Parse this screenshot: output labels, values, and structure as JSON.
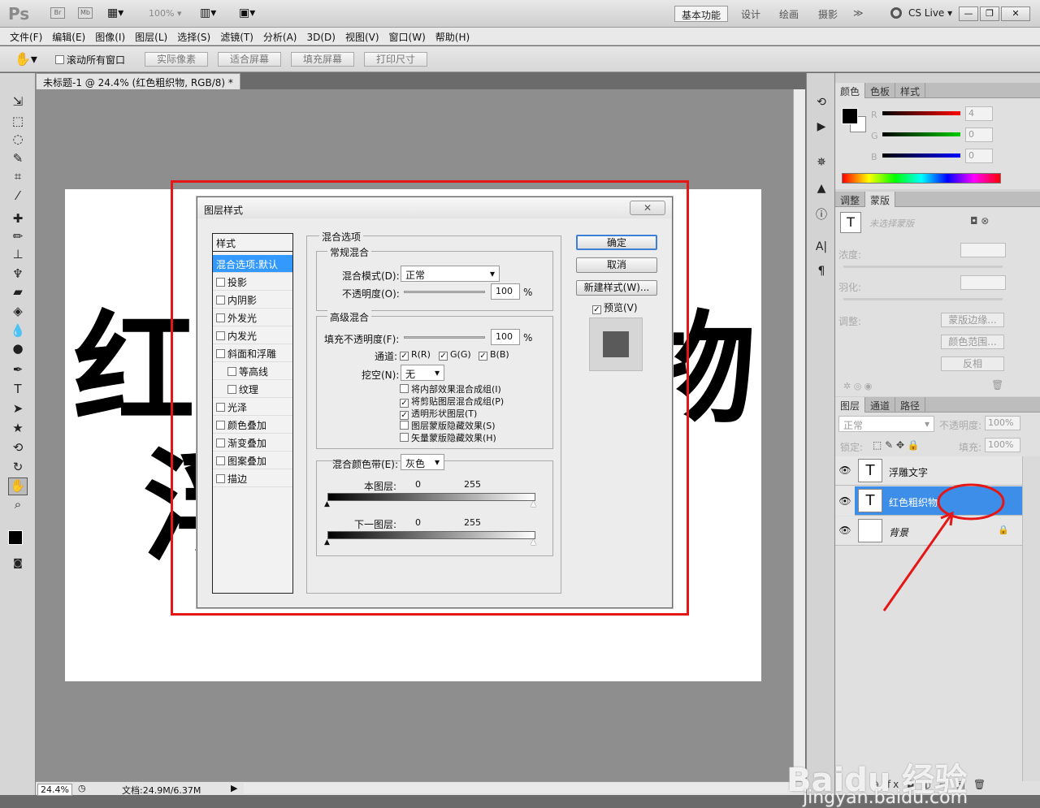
{
  "appbar": {
    "logo": "Ps",
    "icons": [
      "Br",
      "Mb"
    ],
    "zoom": "100%",
    "workspaces": [
      "基本功能",
      "设计",
      "绘画",
      "摄影"
    ],
    "more": "≫",
    "cslive": "CS Live ▾",
    "window_buttons": [
      "—",
      "❐",
      "✕"
    ]
  },
  "menu": [
    "文件(F)",
    "编辑(E)",
    "图像(I)",
    "图层(L)",
    "选择(S)",
    "滤镜(T)",
    "分析(A)",
    "3D(D)",
    "视图(V)",
    "窗口(W)",
    "帮助(H)"
  ],
  "options": {
    "scroll_all": "滚动所有窗口",
    "buttons": [
      "实际像素",
      "适合屏幕",
      "填充屏幕",
      "打印尺寸"
    ]
  },
  "document": {
    "tab_title": "未标题-1 @ 24.4% (红色粗织物, RGB/8) *",
    "canvas_text_line1": [
      "红",
      "物"
    ],
    "canvas_text_line2": "浮",
    "zoom": "24.4%",
    "doc_info": "文档:24.9M/6.37M"
  },
  "color_panel": {
    "tabs": [
      "颜色",
      "色板",
      "样式"
    ],
    "r_label": "R",
    "g_label": "G",
    "b_label": "B",
    "r": "4",
    "g": "0",
    "b": "0"
  },
  "mask_panel": {
    "tabs": [
      "调整",
      "蒙版"
    ],
    "status": "未选择蒙版",
    "density": "浓度:",
    "feather": "羽化:",
    "refine_label": "调整:",
    "buttons": [
      "蒙版边缘...",
      "颜色范围...",
      "反相"
    ]
  },
  "layers_panel": {
    "tabs": [
      "图层",
      "通道",
      "路径"
    ],
    "blend_mode": "正常",
    "opacity_label": "不透明度:",
    "opacity": "100%",
    "lock_label": "锁定:",
    "fill_label": "填充:",
    "fill": "100%",
    "layers": [
      {
        "name": "浮雕文字",
        "thumb": "T",
        "selected": false
      },
      {
        "name": "红色粗织物",
        "thumb": "T",
        "selected": true
      },
      {
        "name": "背景",
        "thumb": "",
        "selected": false
      }
    ],
    "bottom_icons": "⊖ fx ◘ ◐ ▭ ▣ 🗑"
  },
  "watermark": {
    "brand": "Baidu 经验",
    "url": "jingyan.baidu.com"
  },
  "dialog": {
    "title": "图层样式",
    "styles_header": "样式",
    "styles": [
      {
        "label": "混合选项:默认",
        "selected": true,
        "checkbox": false,
        "indent": false
      },
      {
        "label": "投影",
        "checkbox": true,
        "indent": false
      },
      {
        "label": "内阴影",
        "checkbox": true,
        "indent": false
      },
      {
        "label": "外发光",
        "checkbox": true,
        "indent": false
      },
      {
        "label": "内发光",
        "checkbox": true,
        "indent": false
      },
      {
        "label": "斜面和浮雕",
        "checkbox": true,
        "indent": false
      },
      {
        "label": "等高线",
        "checkbox": true,
        "indent": true
      },
      {
        "label": "纹理",
        "checkbox": true,
        "indent": true
      },
      {
        "label": "光泽",
        "checkbox": true,
        "indent": false
      },
      {
        "label": "颜色叠加",
        "checkbox": true,
        "indent": false
      },
      {
        "label": "渐变叠加",
        "checkbox": true,
        "indent": false
      },
      {
        "label": "图案叠加",
        "checkbox": true,
        "indent": false
      },
      {
        "label": "描边",
        "checkbox": true,
        "indent": false
      }
    ],
    "blend_options_title": "混合选项",
    "general_title": "常规混合",
    "blend_mode_label": "混合模式(D):",
    "blend_mode_value": "正常",
    "opacity_label": "不透明度(O):",
    "opacity_value": "100",
    "percent": "%",
    "advanced_title": "高级混合",
    "fill_opacity_label": "填充不透明度(F):",
    "fill_opacity_value": "100",
    "channels_label": "通道:",
    "channel_r": "R(R)",
    "channel_g": "G(G)",
    "channel_b": "B(B)",
    "knockout_label": "挖空(N):",
    "knockout_value": "无",
    "opt1": "将内部效果混合成组(I)",
    "opt2": "将剪贴图层混合成组(P)",
    "opt3": "透明形状图层(T)",
    "opt4": "图层蒙版隐藏效果(S)",
    "opt5": "矢量蒙版隐藏效果(H)",
    "blend_if_label": "混合颜色带(E):",
    "blend_if_value": "灰色",
    "this_layer": "本图层:",
    "under_layer": "下一图层:",
    "range_min": "0",
    "range_max": "255",
    "ok": "确定",
    "cancel": "取消",
    "new_style": "新建样式(W)...",
    "preview": "预览(V)",
    "close": "✕"
  }
}
